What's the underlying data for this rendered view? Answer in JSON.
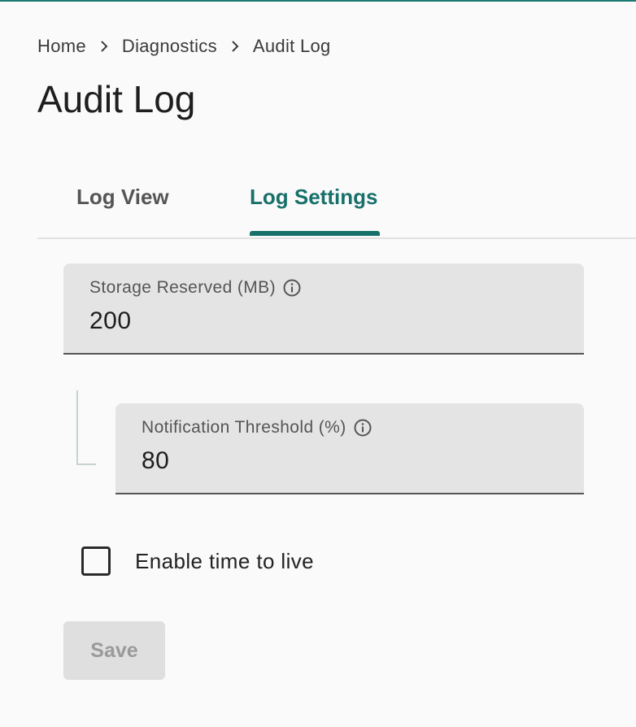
{
  "breadcrumb": {
    "items": [
      "Home",
      "Diagnostics",
      "Audit Log"
    ]
  },
  "page_title": "Audit Log",
  "tabs": [
    {
      "label": "Log View",
      "active": false
    },
    {
      "label": "Log Settings",
      "active": true
    }
  ],
  "form": {
    "storage_reserved": {
      "label": "Storage Reserved (MB)",
      "value": "200",
      "icon": "info-icon"
    },
    "notification_threshold": {
      "label": "Notification Threshold (%)",
      "value": "80",
      "icon": "info-icon"
    },
    "enable_ttl": {
      "label": "Enable time to live",
      "checked": false
    },
    "save_label": "Save"
  },
  "colors": {
    "accent": "#18706a",
    "field_bg": "#e3e4e3",
    "background": "#fafafa",
    "disabled_button_bg": "#dfdfdf",
    "disabled_button_text": "#9a9a9a"
  }
}
